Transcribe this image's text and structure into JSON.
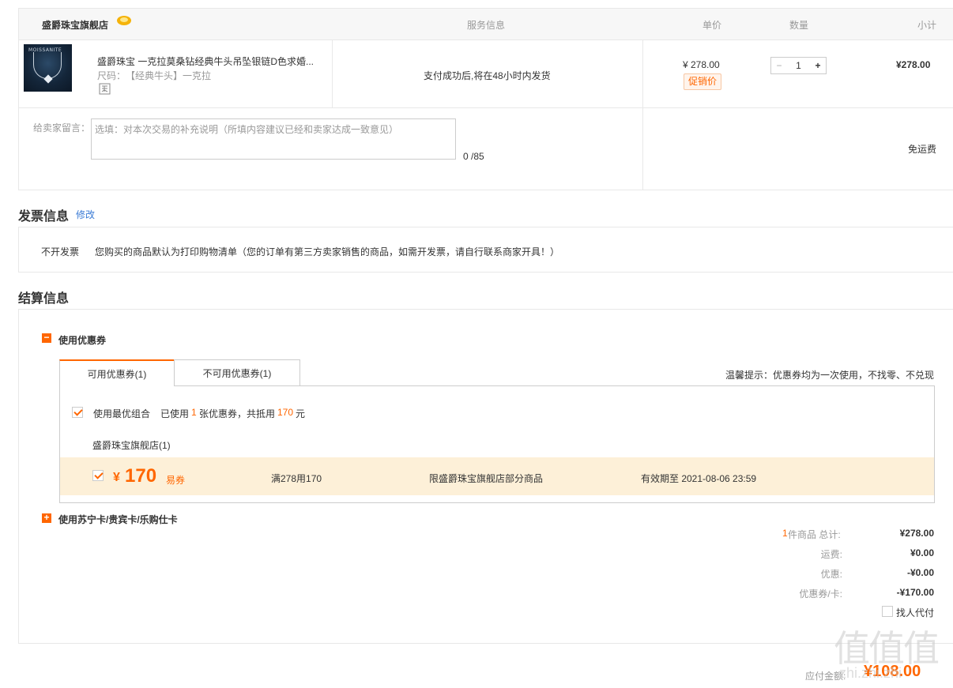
{
  "store": {
    "name": "盛爵珠宝旗舰店",
    "headers": {
      "service": "服务信息",
      "price": "单价",
      "qty": "数量",
      "subtotal": "小计"
    }
  },
  "product": {
    "title": "盛爵珠宝 一克拉莫桑钻经典牛头吊坠银链D色求婚...",
    "spec_label": "尺码：",
    "spec_value": "【经典牛头】一克拉",
    "service": "支付成功后,将在48小时内发货",
    "price": "¥ 278.00",
    "promo_tag": "促销价",
    "qty": "1",
    "qty_minus": "−",
    "qty_plus": "+",
    "subtotal": "¥278.00",
    "thumb_brand": "MOISSANITE"
  },
  "message": {
    "label": "给卖家留言：",
    "placeholder": "选填：对本次交易的补充说明（所填内容建议已经和卖家达成一致意见）",
    "counter": "0 /85",
    "shipping": "免运费"
  },
  "invoice": {
    "title": "发票信息",
    "edit": "修改",
    "type": "不开发票",
    "note": "您购买的商品默认为打印购物清单（您的订单有第三方卖家销售的商品，如需开发票，请自行联系商家开具！）"
  },
  "settlement": {
    "title": "结算信息",
    "coupon_section": "使用优惠券",
    "tab_available": "可用优惠券(1)",
    "tab_unavailable": "不可用优惠券(1)",
    "hint": "温馨提示：优惠券均为一次使用，不找零、不兑现",
    "best_combo": "使用最优组合",
    "used_prefix": "已使用",
    "used_count": "1",
    "used_mid": "张优惠券，共抵用",
    "used_amount": "170",
    "used_suffix": "元",
    "store_group": "盛爵珠宝旗舰店(1)",
    "coupon": {
      "symbol": "¥",
      "amount": "170",
      "type": "易券",
      "rule": "满278用170",
      "scope": "限盛爵珠宝旗舰店部分商品",
      "expiry": "有效期至 2021-08-06 23:59"
    },
    "card_section": "使用苏宁卡/贵宾卡/乐购仕卡"
  },
  "summary": {
    "count": "1",
    "count_label": "件商品 总计:",
    "total": "¥278.00",
    "shipping_label": "运费:",
    "shipping": "¥0.00",
    "discount_label": "优惠:",
    "discount": "-¥0.00",
    "coupon_label": "优惠券/卡:",
    "coupon": "-¥170.00",
    "proxy_pay": "找人代付",
    "payable_label": "应付金额:",
    "payable": "¥108.00"
  },
  "watermark": {
    "main": "值值值",
    "sub": "zhi.zhi.zhi"
  },
  "colors": {
    "accent": "#ff6600",
    "link": "#3a7bd5",
    "coupon_bg": "#fdf0d8"
  }
}
